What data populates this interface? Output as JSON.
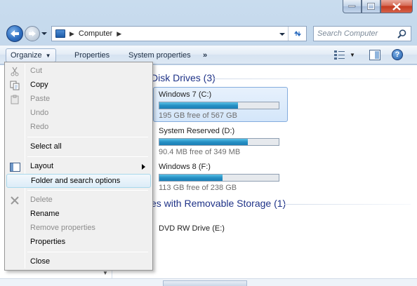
{
  "window": {
    "address": {
      "location": "Computer"
    },
    "search": {
      "placeholder": "Search Computer"
    }
  },
  "toolbar": {
    "organize_label": "Organize",
    "properties_label": "Properties",
    "system_properties_label": "System properties",
    "more_label": "»"
  },
  "content": {
    "hard_disk_heading": "Disk Drives (3)",
    "removable_heading": "es with Removable Storage (1)",
    "drives": [
      {
        "name": "Windows 7 (C:)",
        "free_text": "195 GB free of 567 GB",
        "used_fraction": 0.66,
        "selected": true
      },
      {
        "name": "System Reserved (D:)",
        "free_text": "90.4 MB free of 349 MB",
        "used_fraction": 0.74,
        "selected": false
      },
      {
        "name": "Windows 8 (F:)",
        "free_text": "113 GB free of 238 GB",
        "used_fraction": 0.53,
        "selected": false
      }
    ],
    "removable": [
      {
        "name": "DVD RW Drive (E:)"
      }
    ]
  },
  "menu": {
    "items": [
      {
        "label": "Cut",
        "disabled": true
      },
      {
        "label": "Copy",
        "disabled": false
      },
      {
        "label": "Paste",
        "disabled": true
      },
      {
        "label": "Undo",
        "disabled": true
      },
      {
        "label": "Redo",
        "disabled": true
      },
      {
        "label": "Select all",
        "disabled": false
      },
      {
        "label": "Layout",
        "disabled": false,
        "submenu": true
      },
      {
        "label": "Folder and search options",
        "disabled": false,
        "hover": true
      },
      {
        "label": "Delete",
        "disabled": true
      },
      {
        "label": "Rename",
        "disabled": false
      },
      {
        "label": "Remove properties",
        "disabled": true
      },
      {
        "label": "Properties",
        "disabled": false
      },
      {
        "label": "Close",
        "disabled": false
      }
    ]
  },
  "colors": {
    "heading_blue": "#1e3287",
    "progress_fill": "#2790c4",
    "close_red": "#c3391e"
  }
}
